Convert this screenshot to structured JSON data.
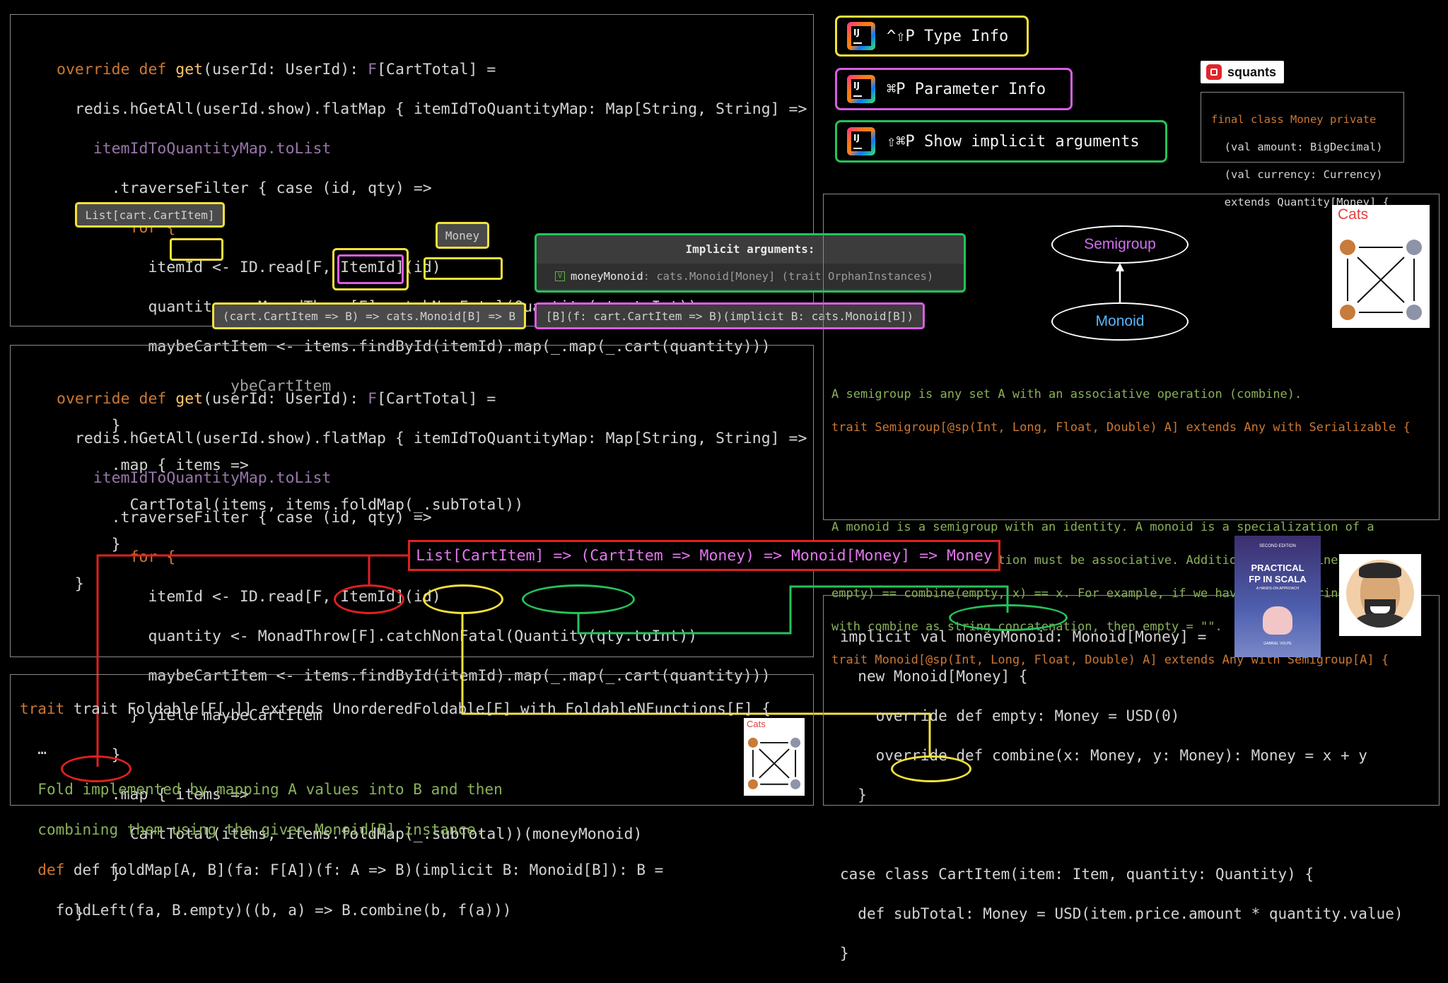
{
  "shortcuts": [
    {
      "keys": "^⇧P Type Info",
      "color": "#f5e23a"
    },
    {
      "keys": "⌘P Parameter Info",
      "color": "#d95ee3"
    },
    {
      "keys": "⇧⌘P Show implicit arguments",
      "color": "#24c35a"
    }
  ],
  "ij_label": "IJ",
  "logo": {
    "brand": "squants"
  },
  "money_snippet": [
    "final class Money private",
    "  (val amount: BigDecimal)",
    "  (val currency: Currency)",
    "  extends Quantity[Money] {"
  ],
  "cats": {
    "label": "Cats",
    "label_small": "Cats"
  },
  "diagram": {
    "top": "Semigroup",
    "bottom": "Monoid"
  },
  "hints": {
    "list_cartitem": "List[cart.CartItem]",
    "money": "Money",
    "foldmap_type": "(cart.CartItem => B) => cats.Monoid[B] => B",
    "param_info": "[B](f: cart.CartItem => B)(implicit B: cats.Monoid[B])",
    "implicit_title": "Implicit arguments:",
    "implicit_value": "moneyMonoid: cats.Monoid[Money]  (trait OrphanInstances)",
    "implicit_check": "V",
    "signature": "List[CartItem] => (CartItem => Money) => Monoid[Money] => Money"
  },
  "code_top": {
    "l1": [
      "override",
      "def",
      "get",
      "(userId: UserId): ",
      "F",
      "[CartTotal] ="
    ],
    "l2": "redis.hGetAll(userId.show).flatMap { itemIdToQuantityMap: Map[String, String] =>",
    "l3": "itemIdToQuantityMap.toList",
    "l4": ".traverseFilter { case (id, qty) =>",
    "l5": "for {",
    "l6": "itemId <- ID.read[F, ItemId](id)",
    "l7": "quantity <- MonadThrow[F].catchNonFatal(Quantity(qty.toInt))",
    "l8": "maybeCartItem <- items.findById(itemId).map(_.map(_.cart(quantity)))",
    "l9": "} yield maybeCartItem",
    "l10": "}",
    "l11": ".map { items =>",
    "l12": "CartTotal(items, items.foldMap(_.subTotal))",
    "l13": "}",
    "l14": "}"
  },
  "code_bottom": {
    "l12": "CartTotal(items, items.foldMap(_.subTotal))(moneyMonoid)"
  },
  "foldable": {
    "l1": "trait Foldable[F[_]] extends UnorderedFoldable[F] with FoldableNFunctions[F] {",
    "l2": "…",
    "l3": "Fold implemented by mapping A values into B and then",
    "l4": "combining them using the given Monoid[B] instance.",
    "l5": "def foldMap[A, B](fa: F[A])(f: A => B)(implicit B: Monoid[B]): B =",
    "l6": "foldLeft(fa, B.empty)((b, a) => B.combine(b, f(a)))"
  },
  "semigroup_doc": {
    "l1": "A semigroup is any set A with an associative operation (combine).",
    "l2": "trait Semigroup[@sp(Int, Long, Float, Double) A] extends Any with Serializable {",
    "l3": "A monoid is a semigroup with an identity. A monoid is a specialization of a",
    "l4": "semigroup, so its operation must be associative. Additionally, combine(x,",
    "l5": "empty) == combine(empty, x) == x. For example, if we have Monoid[String],",
    "l6": "with combine as string concatenation, then empty = \"\".",
    "l7": "trait Monoid[@sp(Int, Long, Float, Double) A] extends Any with Semigroup[A] {"
  },
  "instance": {
    "l1": "implicit val moneyMonoid: Monoid[Money] =",
    "l2": "new Monoid[Money] {",
    "l3": "override def empty: Money = USD(0)",
    "l4": "override def combine(x: Money, y: Money): Money = x + y",
    "l5": "}",
    "l6": "case class CartItem(item: Item, quantity: Quantity) {",
    "l7": "def subTotal: Money = USD(item.price.amount * quantity.value)",
    "l8": "}"
  },
  "book": {
    "edition": "SECOND EDITION",
    "title1": "PRACTICAL",
    "title2": "FP IN SCALA",
    "subtitle": "A HANDS-ON APPROACH",
    "author": "GABRIEL VOLPE"
  },
  "colors": {
    "yellow": "#f5e23a",
    "green": "#24c35a",
    "pink": "#d95ee3",
    "red": "#e02020"
  }
}
